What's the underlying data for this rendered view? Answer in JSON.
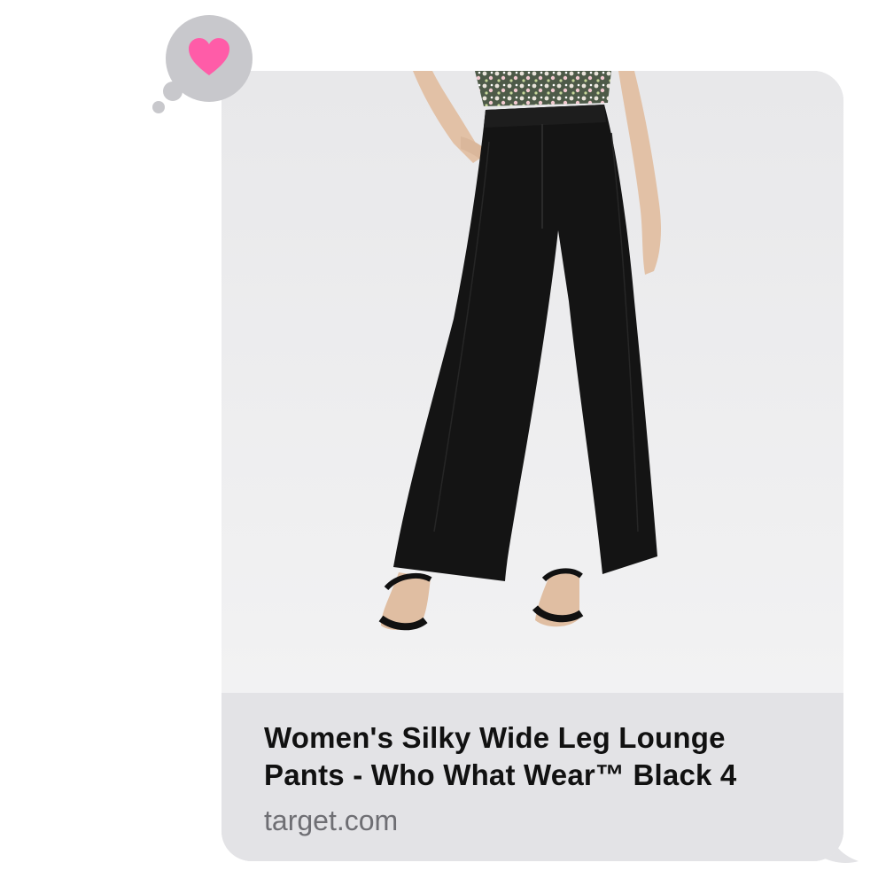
{
  "reaction": {
    "icon": "heart-icon",
    "color": "#ff5ca8",
    "bubble_color": "#c8c8cc"
  },
  "link_preview": {
    "image": {
      "icon": "product-photo",
      "subject": "wide-leg-pants"
    },
    "title": "Women's Silky Wide Leg Lounge Pants - Who What Wear™ Black 4",
    "domain": "target.com",
    "bubble_color": "#e9e9eb",
    "caption_color": "#e3e3e6"
  }
}
